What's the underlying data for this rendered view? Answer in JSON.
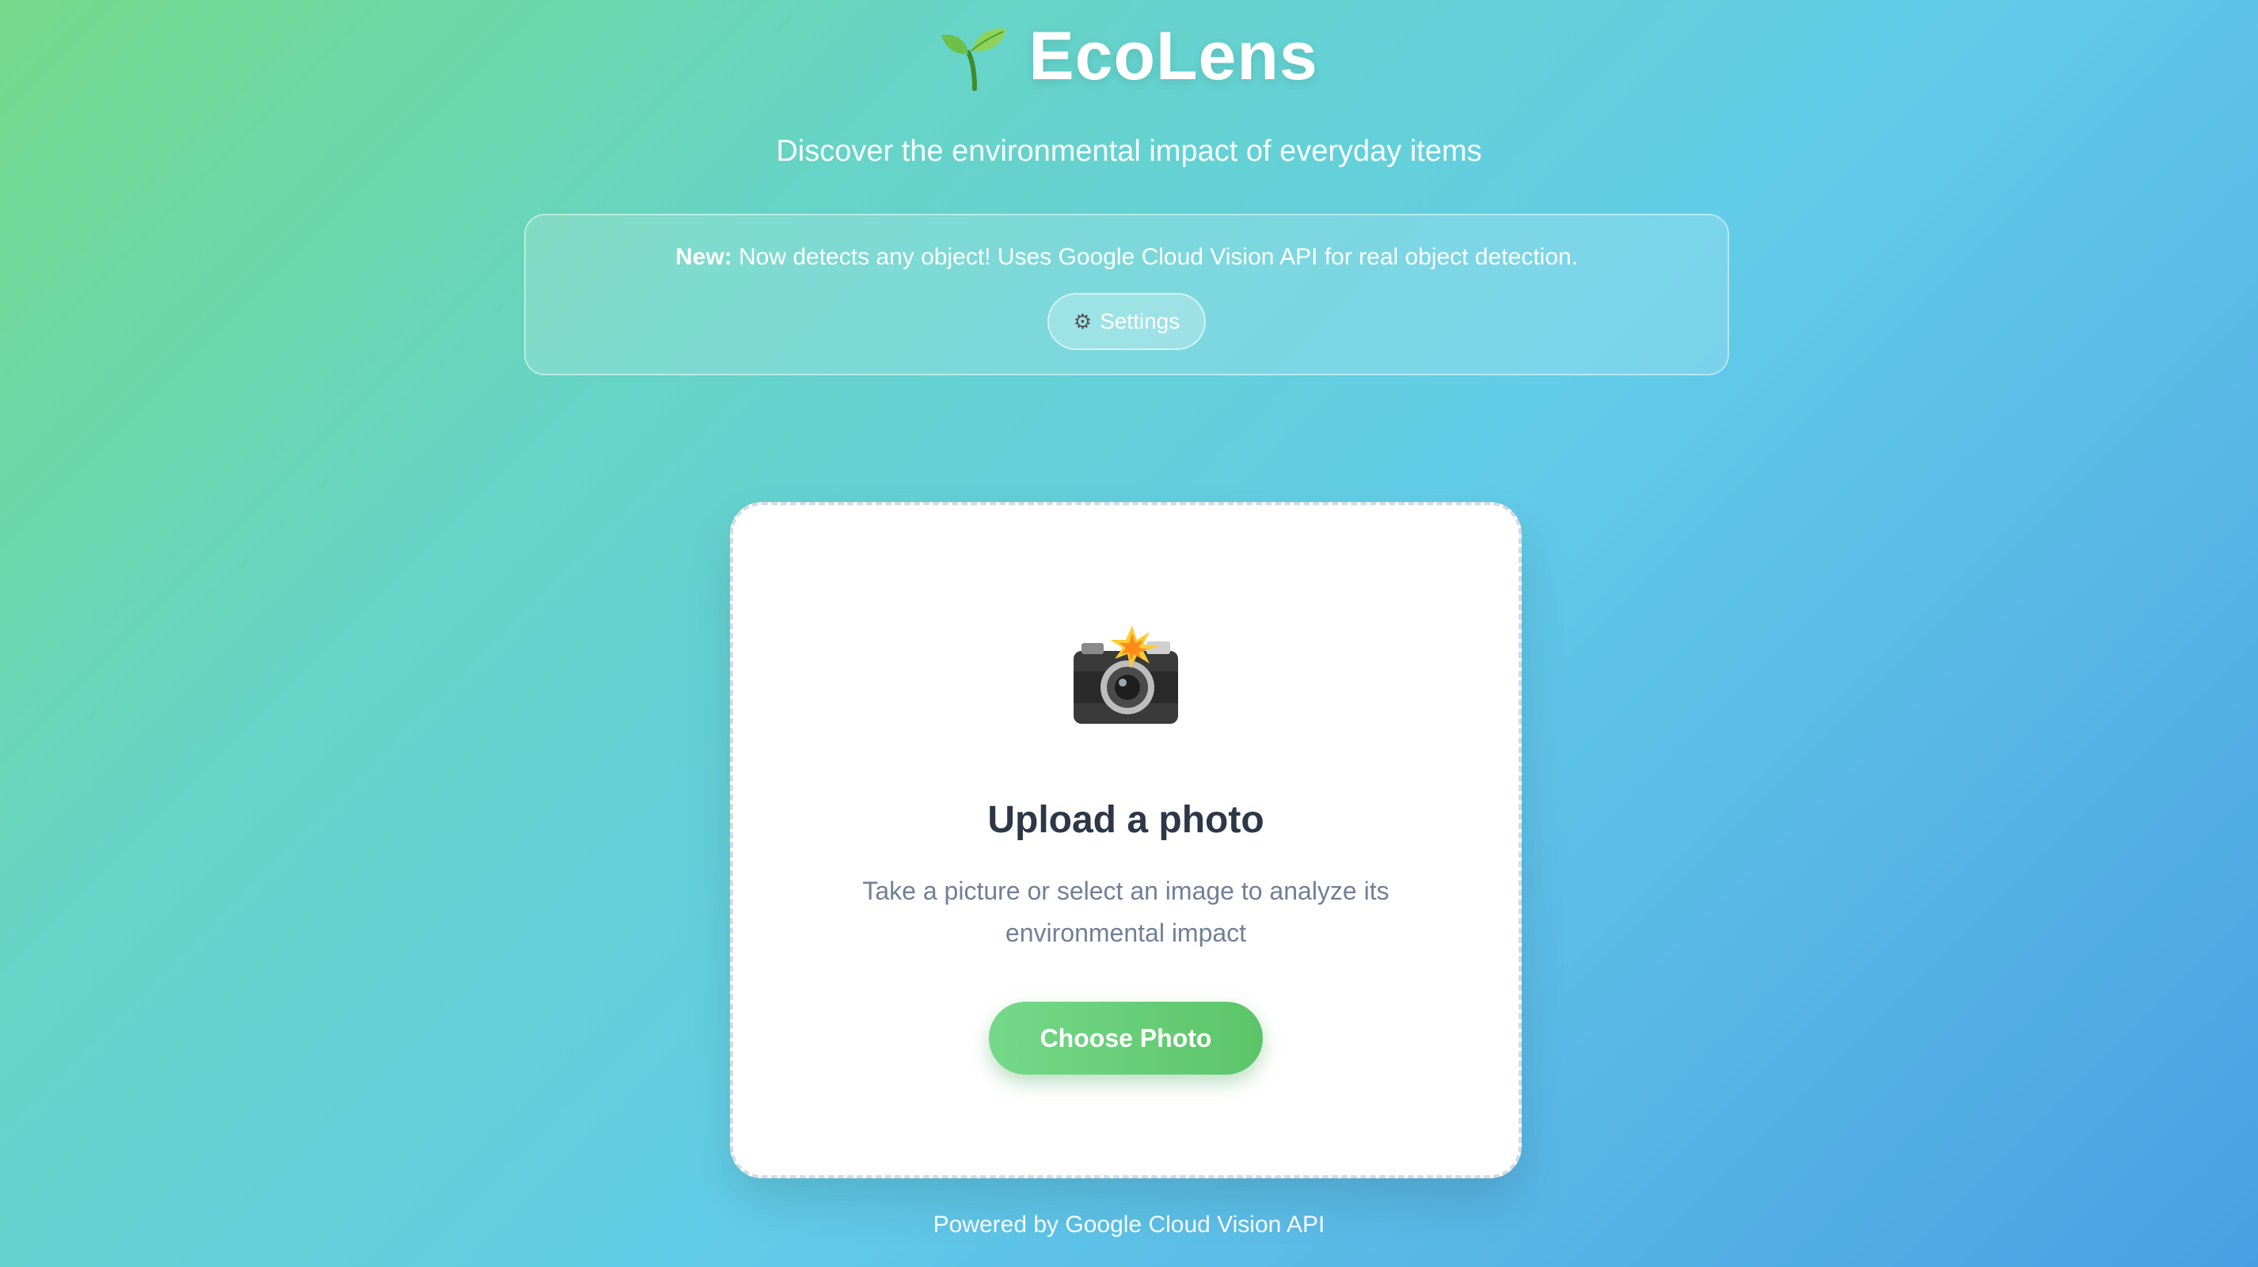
{
  "header": {
    "logo_icon": "seedling-icon",
    "title": "EcoLens",
    "subtitle": "Discover the environmental impact of everyday items"
  },
  "notice": {
    "label": "New:",
    "text": " Now detects any object! Uses Google Cloud Vision API for real object detection.",
    "settings_icon": "gear-icon",
    "settings_label": "Settings"
  },
  "upload": {
    "icon": "camera-flash-icon",
    "title": "Upload a photo",
    "description": "Take a picture or select an image to analyze its environmental impact",
    "button_label": "Choose Photo"
  },
  "footer": {
    "text": "Powered by Google Cloud Vision API"
  },
  "colors": {
    "accent_green": "#5cc468",
    "title_text": "#2d3748",
    "body_text": "#718096"
  }
}
